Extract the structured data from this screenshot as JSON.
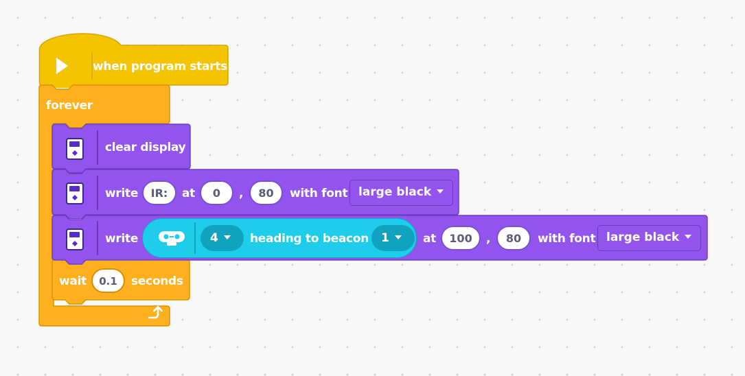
{
  "hat": {
    "label": "when program starts",
    "icon": "play-icon"
  },
  "forever": {
    "label": "forever",
    "loop_icon": "loop-arrow-icon"
  },
  "clear_display": {
    "label": "clear display",
    "icon": "display-icon"
  },
  "write1": {
    "label": "write",
    "text_value": "IR:",
    "at_label": "at",
    "x_value": "0",
    "comma": ",",
    "y_value": "80",
    "font_label": "with font",
    "font_value": "large black",
    "icon": "display-icon"
  },
  "write2": {
    "label": "write",
    "sensor": {
      "icon": "infrared-sensor-icon",
      "port_value": "4",
      "label": "heading to beacon",
      "channel_value": "1"
    },
    "at_label": "at",
    "x_value": "100",
    "comma": ",",
    "y_value": "80",
    "font_label": "with font",
    "font_value": "large black",
    "icon": "display-icon"
  },
  "wait": {
    "label": "wait",
    "value": "0.1",
    "unit": "seconds"
  },
  "colors": {
    "hat": "#f5c400",
    "control": "#ffb01e",
    "display": "#9254ec",
    "sensor": "#1ecde9"
  }
}
